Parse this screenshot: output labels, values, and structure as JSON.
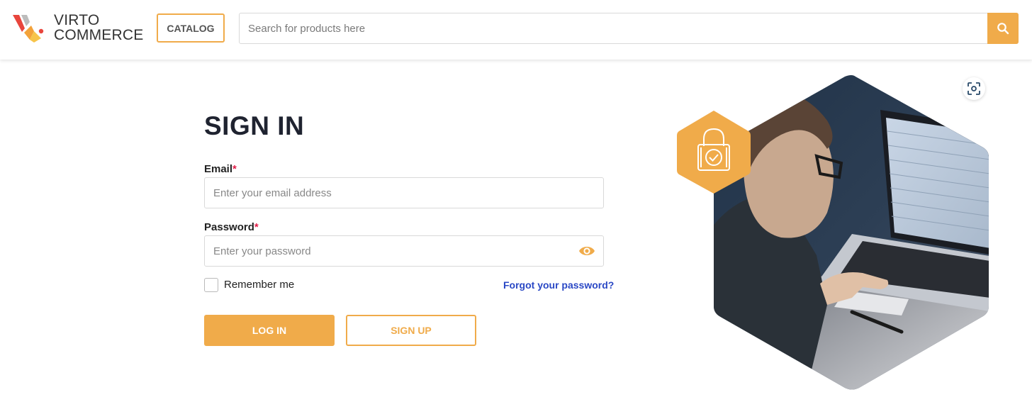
{
  "header": {
    "logo_line1": "VIRTO",
    "logo_line2": "COMMERCE",
    "catalog_label": "CATALOG",
    "search_placeholder": "Search for products here",
    "icons": {
      "search": "search-icon",
      "logo": "virto-logo-icon"
    }
  },
  "signin": {
    "title": "SIGN IN",
    "email_label": "Email",
    "email_placeholder": "Enter your email address",
    "password_label": "Password",
    "password_placeholder": "Enter your password",
    "required_mark": "*",
    "remember_label": "Remember me",
    "remember_checked": false,
    "forgot_label": "Forgot your password?",
    "login_label": "LOG IN",
    "signup_label": "SIGN UP",
    "icons": {
      "password_toggle": "eye-icon"
    }
  },
  "hero": {
    "icons": {
      "badge": "lock-check-icon",
      "capture": "screen-capture-icon"
    },
    "image": "person-using-laptop-photo"
  },
  "colors": {
    "accent": "#f0ab4a",
    "link": "#2a48c5",
    "required": "#e11d48",
    "title": "#1f2330"
  }
}
